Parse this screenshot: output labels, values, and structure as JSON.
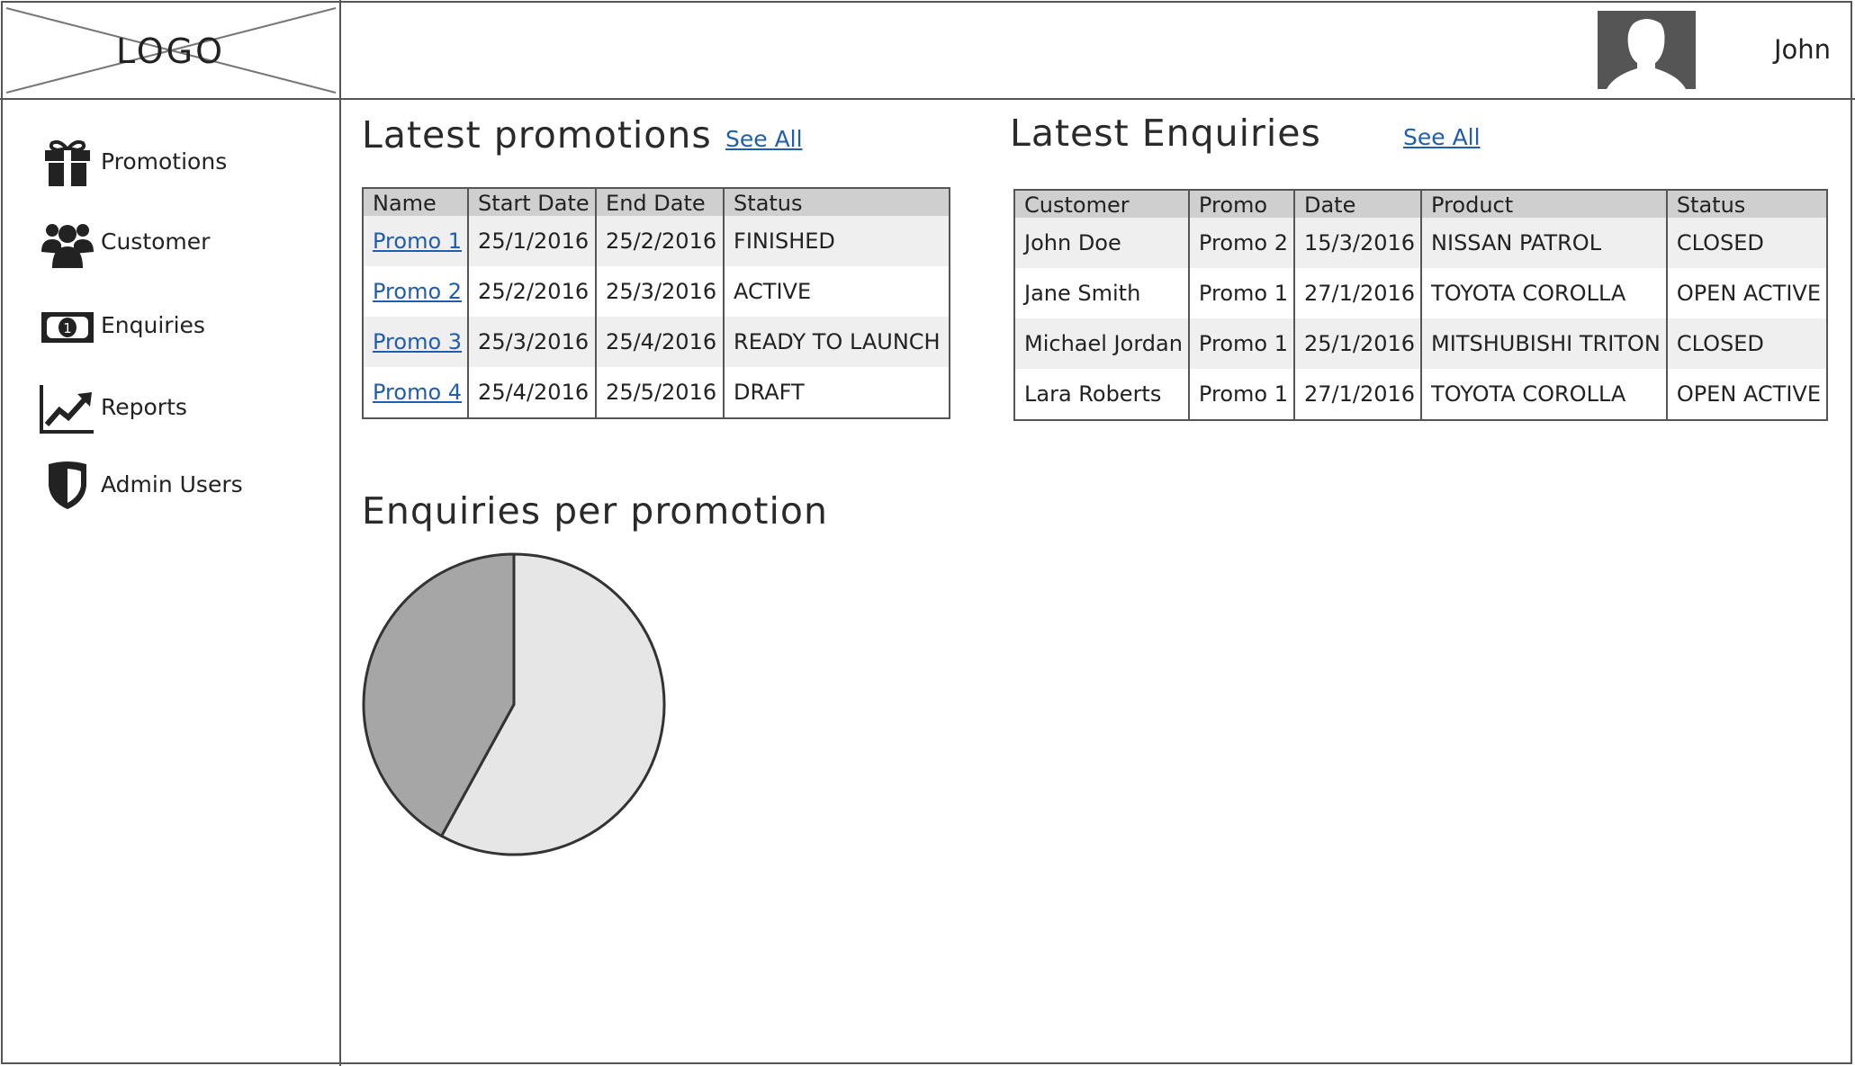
{
  "header": {
    "logo_text": "LOGO",
    "user_name": "John"
  },
  "sidebar": {
    "items": [
      {
        "label": "Promotions",
        "icon": "gift-icon"
      },
      {
        "label": "Customer",
        "icon": "users-icon"
      },
      {
        "label": "Enquiries",
        "icon": "money-icon"
      },
      {
        "label": "Reports",
        "icon": "chart-line-icon"
      },
      {
        "label": "Admin Users",
        "icon": "shield-icon"
      }
    ]
  },
  "promotions": {
    "title": "Latest promotions",
    "see_all": "See All",
    "columns": [
      "Name",
      "Start Date",
      "End Date",
      "Status"
    ],
    "rows": [
      [
        "Promo 1",
        "25/1/2016",
        "25/2/2016",
        "FINISHED"
      ],
      [
        "Promo 2",
        "25/2/2016",
        "25/3/2016",
        "ACTIVE"
      ],
      [
        "Promo 3",
        "25/3/2016",
        "25/4/2016",
        "READY TO LAUNCH"
      ],
      [
        "Promo 4",
        "25/4/2016",
        "25/5/2016",
        "DRAFT"
      ]
    ]
  },
  "enquiries": {
    "title": "Latest Enquiries",
    "see_all": "See All",
    "columns": [
      "Customer",
      "Promo",
      "Date",
      "Product",
      "Status"
    ],
    "rows": [
      [
        "John Doe",
        "Promo 2",
        "15/3/2016",
        "NISSAN PATROL",
        "CLOSED"
      ],
      [
        "Jane Smith",
        "Promo 1",
        "27/1/2016",
        "TOYOTA COROLLA",
        "OPEN ACTIVE"
      ],
      [
        "Michael Jordan",
        "Promo 1",
        "25/1/2016",
        "MITSHUBISHI TRITON",
        "CLOSED"
      ],
      [
        "Lara Roberts",
        "Promo 1",
        "27/1/2016",
        "TOYOTA COROLLA",
        "OPEN ACTIVE"
      ]
    ]
  },
  "chart": {
    "title": "Enquiries per promotion"
  },
  "chart_data": {
    "type": "pie",
    "title": "Enquiries per promotion",
    "values": [
      58,
      42
    ],
    "colors": [
      "#e6e6e6",
      "#a6a6a6"
    ]
  },
  "colors": {
    "link": "#1f5db1",
    "header_row": "#cfcfcf",
    "alt_row": "#efefef",
    "border": "#555555"
  }
}
